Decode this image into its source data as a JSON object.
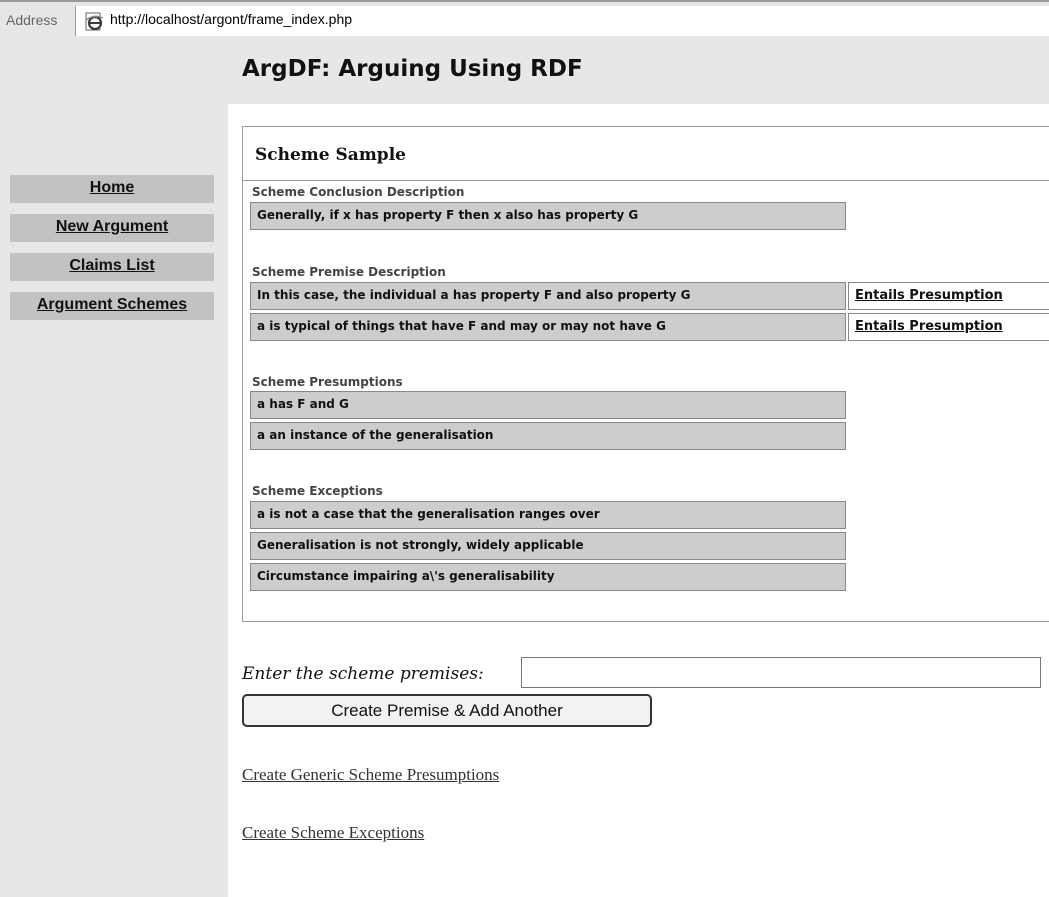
{
  "address_bar": {
    "label": "Address",
    "url": "http://localhost/argont/frame_index.php",
    "icon": "ie-page-icon"
  },
  "site": {
    "title": "ArgDF: Arguing Using RDF"
  },
  "nav": {
    "items": [
      {
        "label": "Home"
      },
      {
        "label": "New Argument"
      },
      {
        "label": "Claims List"
      },
      {
        "label": "Argument Schemes"
      }
    ]
  },
  "scheme": {
    "title": "Scheme Sample",
    "conclusion": {
      "label": "Scheme Conclusion Description",
      "value": "Generally, if x has property F then x also has property G"
    },
    "premises": {
      "label": "Scheme Premise Description",
      "rows": [
        {
          "text": "In this case, the individual a has property F and also property G",
          "link": "Entails Presumption"
        },
        {
          "text": "a is typical of things that have F and may or may not have G",
          "link": "Entails Presumption"
        }
      ]
    },
    "presumptions": {
      "label": "Scheme Presumptions",
      "rows": [
        "a has F and G",
        "a an instance of the generalisation"
      ]
    },
    "exceptions": {
      "label": "Scheme Exceptions",
      "rows": [
        "a is not a case that the generalisation ranges over",
        "Generalisation is not strongly, widely applicable",
        "Circumstance impairing a\\'s generalisability"
      ]
    }
  },
  "form": {
    "enter_label": "Enter the scheme premises:",
    "input_value": "",
    "create_button": "Create Premise & Add Another"
  },
  "links": {
    "presumptions": "Create Generic Scheme Presumptions",
    "exceptions": "Create Scheme Exceptions"
  }
}
